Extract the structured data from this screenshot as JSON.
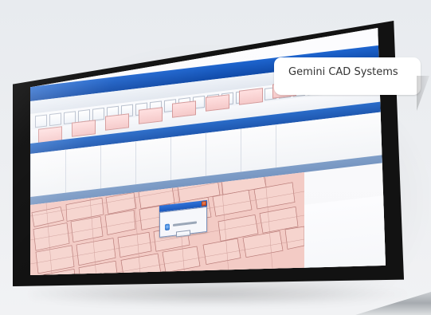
{
  "caption": {
    "label": "Gemini CAD Systems"
  },
  "colors": {
    "background": "#eceef1",
    "bezel": "#121212",
    "screen_map": "#f3cbc5",
    "title_blue": "#1f58b0",
    "caption_bg": "#ffffff",
    "caption_text": "#333333"
  }
}
